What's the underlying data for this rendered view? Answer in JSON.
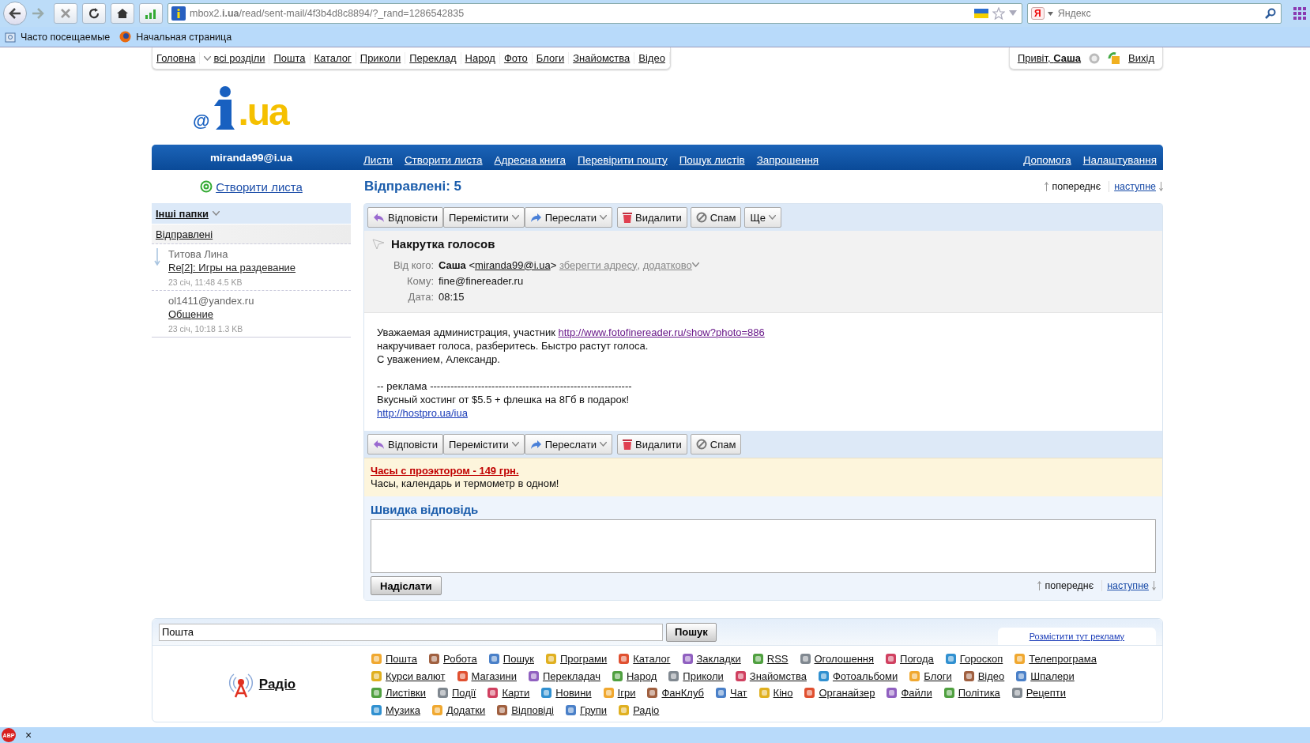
{
  "browser": {
    "url": "mbox2.**i.ua**/read/sent-mail/4f3b4d8c8894/?_rand=1286542835",
    "search_badge": "Я",
    "search_placeholder": "Яндекс",
    "bookmarks": [
      "Часто посещаемые",
      "Начальная страница"
    ]
  },
  "site_nav": {
    "items": [
      {
        "label": "Головна",
        "dropdown": false
      },
      {
        "label": "всі розділи",
        "dropdown": true
      },
      {
        "label": "Пошта",
        "dropdown": false
      },
      {
        "label": "Каталог",
        "dropdown": false
      },
      {
        "label": "Приколи",
        "dropdown": false
      },
      {
        "label": "Переклад",
        "dropdown": false
      },
      {
        "label": "Народ",
        "dropdown": false
      },
      {
        "label": "Фото",
        "dropdown": false
      },
      {
        "label": "Блоги",
        "dropdown": false
      },
      {
        "label": "Знайомства",
        "dropdown": false
      },
      {
        "label": "Відео",
        "dropdown": false
      }
    ],
    "greeting": "Привіт, **Саша**",
    "logout": "Вихід"
  },
  "logo": {
    "prefix": "@",
    "suffix": ".ua"
  },
  "mail_bar": {
    "account": "miranda99@i.ua",
    "links": [
      "Листи",
      "Створити листа",
      "Адресна книга",
      "Перевірити пошту",
      "Пошук листів",
      "Запрошення"
    ],
    "right_links": [
      "Допомога",
      "Налаштування"
    ]
  },
  "sidebar": {
    "compose": "Створити листа",
    "folder_menu": "Інші папки",
    "folders": [
      {
        "label": "Відправлені",
        "selected": true
      }
    ],
    "messages": [
      {
        "from": "Титова Лина",
        "subject": "Re[2]: Игры на раздевание",
        "meta": "23 січ, 11:48 4.5 KB",
        "selected": true
      },
      {
        "from": "ol1411@yandex.ru",
        "subject": "Общение",
        "meta": "23 січ, 10:18 1.3 KB",
        "selected": false
      }
    ]
  },
  "folder_title": "Відправлені: 5",
  "pager": {
    "prev": "попереднє",
    "next": "наступне"
  },
  "toolbar": [
    {
      "label": "Відповісти",
      "kind": "reply",
      "dropdown": false
    },
    {
      "label": "Перемістити",
      "kind": "move",
      "dropdown": true
    },
    {
      "label": "Переслати",
      "kind": "forward",
      "dropdown": true
    },
    {
      "label": "Видалити",
      "kind": "delete",
      "dropdown": false
    },
    {
      "label": "Спам",
      "kind": "spam",
      "dropdown": false
    },
    {
      "label": "Ще",
      "kind": "more",
      "dropdown": true
    }
  ],
  "message": {
    "subject": "Накрутка голосов",
    "from_label": "Від кого:",
    "sender": "Саша",
    "bracket_open": "<",
    "email": "miranda99@i.ua",
    "bracket_close": ">",
    "actions": [
      {
        "label": "зберегти адресу",
        "dropdown": false
      },
      {
        "label": "додатково",
        "dropdown": true
      }
    ],
    "action_separator": ",",
    "to_label": "Кому:",
    "to": "fine@finereader.ru",
    "date_label": "Дата:",
    "date": "08:15",
    "body": [
      {
        "lines": [
          {
            "text": "Уважаемая администрация, участник ",
            "link": "http://www.fotofinereader.ru/show?photo=886",
            "visited": true
          },
          {
            "text": "накручивает голоса, разберитесь. Быстро растут голоса."
          },
          {
            "text": "С уважением, Александр."
          }
        ]
      },
      {
        "lines": [
          {
            "text": "-- реклама -----------------------------------------------------------"
          },
          {
            "text": "Вкусный хостинг от $5.5 + флешка на 8Гб в подарок!"
          },
          {
            "link": "http://hostpro.ua/iua",
            "visited": false
          }
        ]
      }
    ]
  },
  "toolbar_bottom": [
    {
      "label": "Відповісти",
      "kind": "reply",
      "dropdown": false
    },
    {
      "label": "Перемістити",
      "kind": "move",
      "dropdown": true
    },
    {
      "label": "Переслати",
      "kind": "forward",
      "dropdown": true
    },
    {
      "label": "Видалити",
      "kind": "delete",
      "dropdown": false
    },
    {
      "label": "Спам",
      "kind": "spam",
      "dropdown": false
    }
  ],
  "ad": {
    "title": "Часы с проэктором - 149 грн.",
    "text": "Часы, календарь и термометр в одном!"
  },
  "quick_reply": {
    "title": "Швидка відповідь",
    "send": "Надіслати",
    "pager": {
      "prev": "попереднє",
      "next": "наступне"
    }
  },
  "footer": {
    "search_value": "Пошта",
    "search_button": "Пошук",
    "ad_link": "Розмістити тут рекламу",
    "radio": "Радіо",
    "service_rows": [
      {
        "items": [
          "Пошта",
          "Робота",
          "Пошук",
          "Програми",
          "Каталог",
          "Закладки",
          "RSS",
          "Оголошення",
          "Погода",
          "Гороскоп",
          "Телепрограма"
        ]
      },
      {
        "items": [
          "Курси валют",
          "Магазини",
          "Перекладач",
          "Народ",
          "Приколи",
          "Знайомства",
          "Фотоальбоми",
          "Блоги",
          "Відео",
          "Шпалери"
        ]
      },
      {
        "items": [
          "Листівки",
          "Події",
          "Карти",
          "Новини",
          "Ігри",
          "ФанКлуб",
          "Чат",
          "Кіно",
          "Органайзер",
          "Файли",
          "Політика",
          "Рецепти"
        ]
      },
      {
        "items": [
          "Музика",
          "Додатки",
          "Відповіді",
          "Групи",
          "Радіо"
        ]
      }
    ]
  },
  "status_bar": {
    "badge": "ABP",
    "close": "×"
  }
}
